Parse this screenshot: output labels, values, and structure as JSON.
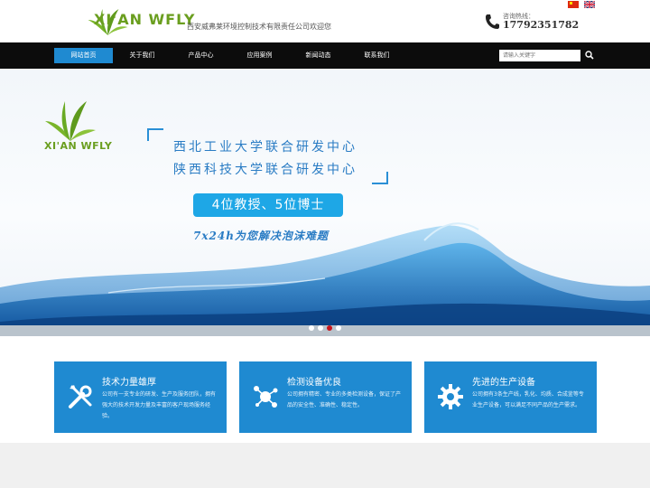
{
  "header": {
    "logo_text": "XI'AN WFLY",
    "welcome": "西安威弗莱环境控制技术有限责任公司欢迎您",
    "hotline_label": "咨询热线：",
    "hotline_number": "17792351782",
    "languages": [
      "中文",
      "English"
    ]
  },
  "nav": {
    "items": [
      {
        "label": "网站首页",
        "active": true
      },
      {
        "label": "关于我们",
        "active": false
      },
      {
        "label": "产品中心",
        "active": false
      },
      {
        "label": "应用案例",
        "active": false
      },
      {
        "label": "新闻动态",
        "active": false
      },
      {
        "label": "联系我们",
        "active": false
      }
    ],
    "search_placeholder": "请输入关键字"
  },
  "banner": {
    "logo_text": "XI'AN WFLY",
    "line1": "西北工业大学联合研发中心",
    "line2": "陕西科技大学联合研发中心",
    "pill": "4位教授、5位博士",
    "tagline": "7x24h为您解决泡沫难题",
    "slide_count": 4,
    "active_slide": 3
  },
  "features": [
    {
      "title": "技术力量雄厚",
      "desc": "公司有一支专业的研发、生产及服务团队，拥有强大的技术开发力量及丰富的客户现场服务经验。",
      "icon": "tools-icon"
    },
    {
      "title": "检测设备优良",
      "desc": "公司拥有精密、专业的多类检测设备，保证了产品的安全性、准确性、稳定性。",
      "icon": "molecule-icon"
    },
    {
      "title": "先进的生产设备",
      "desc": "公司拥有3条生产线，乳化、均质、合成釜等专业生产设备，可以满足不同产品的生产需求。",
      "icon": "gear-icon"
    }
  ],
  "colors": {
    "nav_bg": "#0c0c0c",
    "accent_blue": "#1f8ad1",
    "logo_green": "#6a9e1f",
    "pill_blue": "#1ea7e6",
    "active_dot": "#c8161d"
  }
}
